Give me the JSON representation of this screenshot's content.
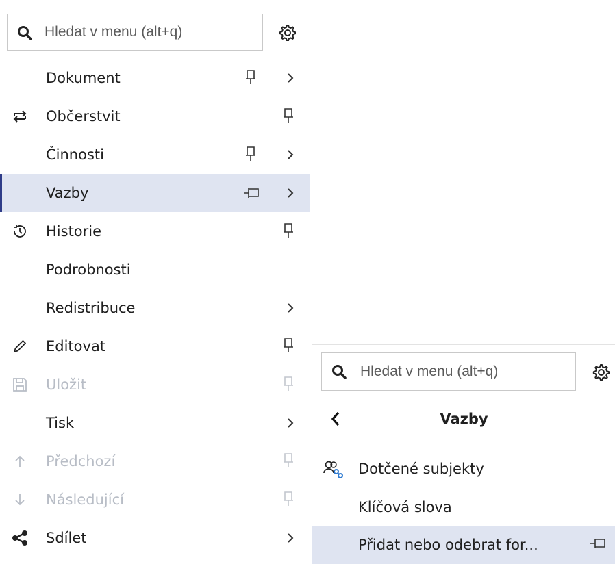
{
  "main_menu": {
    "search": {
      "placeholder": "Hledat v menu (alt+q)",
      "icon": "search-icon"
    },
    "settings_icon": "gear-icon",
    "items": [
      {
        "label": "Dokument",
        "pinnable": true,
        "submenu": true
      },
      {
        "label": "Občerstvit",
        "icon": "refresh-icon",
        "pinnable": true
      },
      {
        "label": "Činnosti",
        "pinnable": true,
        "submenu": true
      },
      {
        "label": "Vazby",
        "pinned": true,
        "submenu": true,
        "selected": true
      },
      {
        "label": "Historie",
        "icon": "history-icon",
        "pinnable": true
      },
      {
        "label": "Podrobnosti"
      },
      {
        "label": "Redistribuce",
        "submenu": true
      },
      {
        "label": "Editovat",
        "icon": "edit-icon",
        "pinnable": true
      },
      {
        "label": "Uložit",
        "icon": "save-icon",
        "pinnable": true,
        "disabled": true
      },
      {
        "label": "Tisk",
        "submenu": true
      },
      {
        "label": "Předchozí",
        "icon": "arrow-up-icon",
        "pinnable": true,
        "disabled": true
      },
      {
        "label": "Následující",
        "icon": "arrow-down-icon",
        "pinnable": true,
        "disabled": true
      },
      {
        "label": "Sdílet",
        "icon": "share-icon",
        "submenu": true
      }
    ]
  },
  "sub_menu": {
    "search": {
      "placeholder": "Hledat v menu (alt+q)",
      "icon": "search-icon"
    },
    "settings_icon": "gear-icon",
    "title": "Vazby",
    "items": [
      {
        "label": "Dotčené subjekty",
        "icon": "people-link-icon"
      },
      {
        "label": "Klíčová slova"
      },
      {
        "label": "Přidat nebo odebrat for...",
        "pinned": true,
        "selected": true
      }
    ]
  },
  "colors": {
    "selected_bg": "#dfe4f1",
    "selected_bar": "#2f3c88",
    "disabled_text": "#b8bdc6",
    "accent_icon": "#2f7bd1"
  }
}
